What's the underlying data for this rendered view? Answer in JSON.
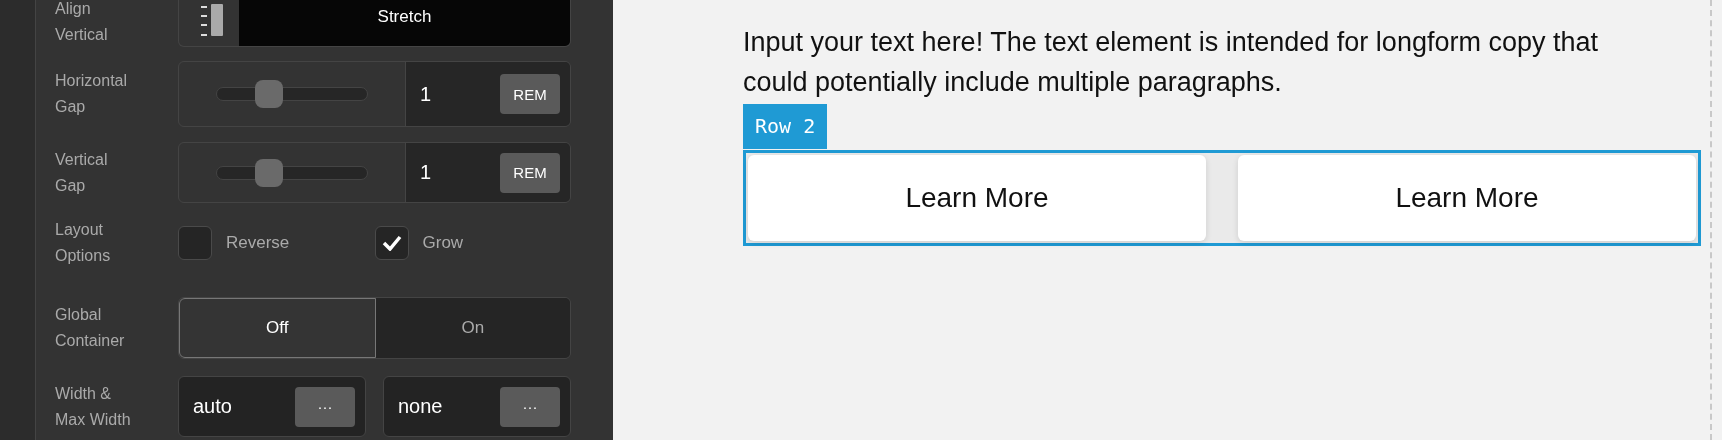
{
  "panel": {
    "fields": [
      {
        "kind": "select",
        "label": "Align Vertical",
        "value": "Stretch"
      },
      {
        "kind": "slider",
        "label": "Horizontal Gap",
        "level": 0.37,
        "value": "1",
        "unit": "REM"
      },
      {
        "kind": "slider",
        "label": "Vertical Gap",
        "level": 0.37,
        "value": "1",
        "unit": "REM"
      },
      {
        "kind": "checks",
        "label": "Layout Options",
        "options": [
          {
            "label": "Reverse",
            "checked": false
          },
          {
            "label": "Grow",
            "checked": true
          }
        ]
      },
      {
        "kind": "toggle",
        "label": "Global Container",
        "options": [
          {
            "label": "Off",
            "selected": true
          },
          {
            "label": "On",
            "selected": false
          }
        ]
      },
      {
        "kind": "pair",
        "label": "Width & Max Width",
        "inputs": [
          {
            "value": "auto",
            "button": "···"
          },
          {
            "value": "none",
            "button": "···"
          }
        ]
      }
    ]
  },
  "canvas": {
    "paragraph": "Input your text here! The text element is intended for longform copy that could potentially include multiple paragraphs.",
    "row": {
      "badge": "Row 2",
      "buttons": [
        "Learn More",
        "Learn More"
      ]
    }
  }
}
